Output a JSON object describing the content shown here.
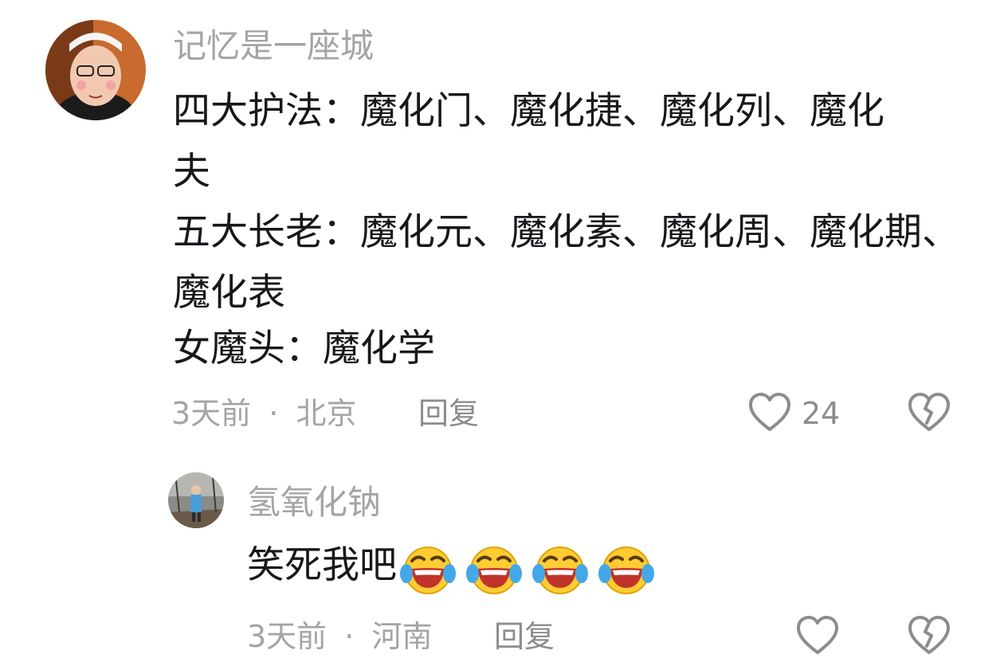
{
  "comment1": {
    "username": "记忆是一座城",
    "lines": [
      "四大护法：魔化门、魔化捷、魔化列、魔化",
      "夫",
      "五大长老：魔化元、魔化素、魔化周、魔化期、",
      "魔化表",
      "女魔头：魔化学"
    ],
    "time": "3天前",
    "location": "北京",
    "reply_label": "回复",
    "like_count": "24"
  },
  "comment2": {
    "username": "氢氧化钠",
    "text": "笑死我吧",
    "emoji": [
      "laugh-cry-emoji",
      "laugh-cry-emoji",
      "laugh-cry-emoji",
      "laugh-cry-emoji"
    ],
    "time": "3天前",
    "location": "河南",
    "reply_label": "回复",
    "like_count": ""
  },
  "meta_separator": "·",
  "colors": {
    "text": "#17171c",
    "secondary": "#a4a4a8",
    "icon": "#8c8c90"
  }
}
